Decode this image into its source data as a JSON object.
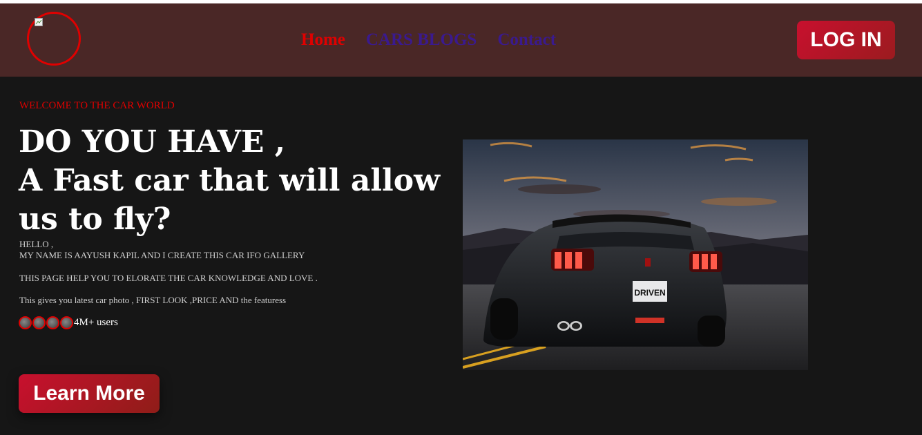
{
  "nav": {
    "links": [
      {
        "label": "Home",
        "color": "#e00000"
      },
      {
        "label": "CARS BLOGS",
        "color": "#3a1a8e"
      },
      {
        "label": "Contact",
        "color": "#3a1a8e"
      }
    ],
    "login_label": "LOG IN"
  },
  "hero": {
    "welcome": "WELCOME TO THE CAR WORLD",
    "headline_lines": [
      "DO YOU HAVE ,",
      "A Fast car that will allow",
      "us to fly?"
    ],
    "desc_lines": [
      "HELLO ,",
      "MY NAME IS AAYUSH KAPIL AND I CREATE THIS CAR IFO GALLERY",
      "THIS PAGE HELP YOU TO ELORATE THE CAR KNOWLEDGE AND LOVE .",
      "This gives you latest car photo , FIRST LOOK ,PRICE AND the featuress"
    ],
    "users_text": "4M+ users",
    "avatar_count": 4,
    "learn_more_label": "Learn More",
    "image_icon": "sports-car-photo",
    "plate_text": "DRIVEN"
  },
  "colors": {
    "navbar_bg": "#4a2726",
    "page_bg": "#161616",
    "accent_red": "#e00000",
    "nav_purple": "#3a1a8e",
    "button_red": "#c8102e"
  }
}
